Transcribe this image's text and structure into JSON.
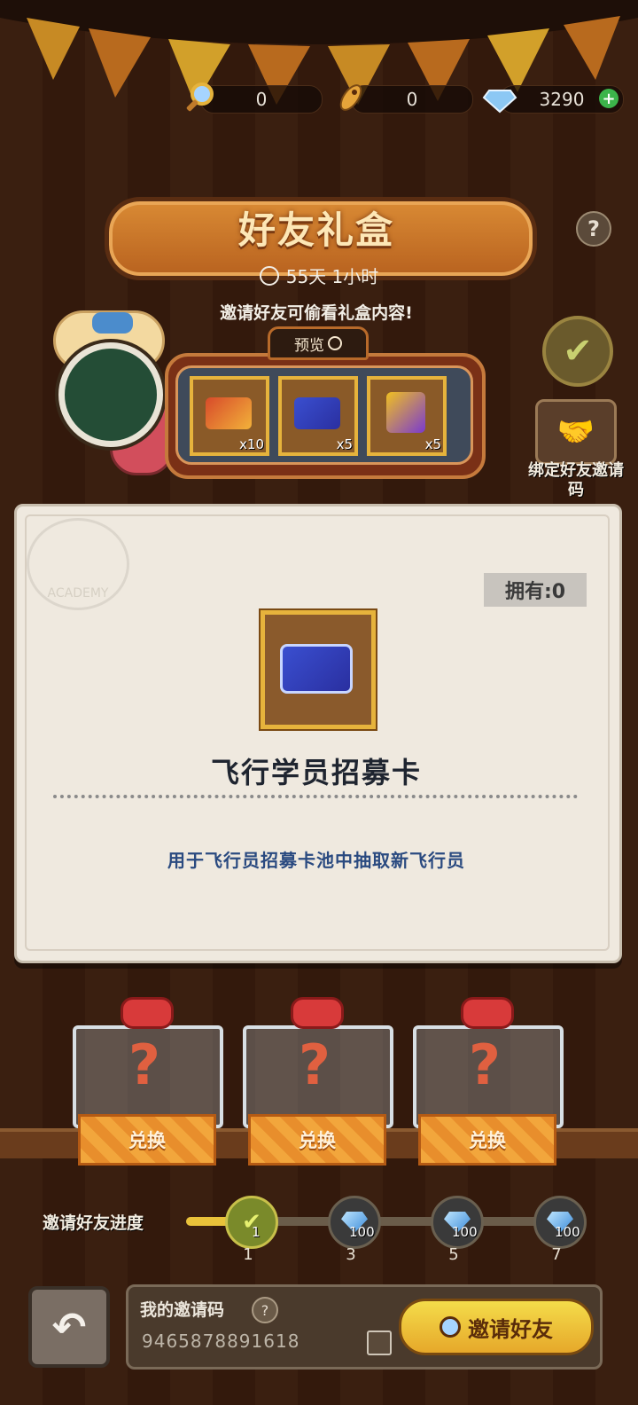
{
  "currency": {
    "magnifier_count": "0",
    "rocket_count": "0",
    "gem_count": "3290"
  },
  "header": {
    "title": "好友礼盒",
    "timer": "55天 1小时",
    "hint": "邀请好友可偷看礼盒内容!",
    "help": "?"
  },
  "preview": {
    "label": "预览",
    "slots": [
      {
        "icon": "gold-recruit-card-icon",
        "qty": "x10"
      },
      {
        "icon": "blue-recruit-card-icon",
        "qty": "x5"
      },
      {
        "icon": "cube-crate-icon",
        "qty": "x5"
      }
    ]
  },
  "side": {
    "bind_label": "绑定好友邀请码"
  },
  "modal": {
    "owned": "拥有:0",
    "item_name": "飞行学员招募卡",
    "item_desc": "用于飞行员招募卡池中抽取新飞行员",
    "stamp_text": "ACADEMY"
  },
  "gifts": [
    {
      "label": "兑换"
    },
    {
      "label": "兑换"
    },
    {
      "label": "兑换"
    }
  ],
  "progress": {
    "label": "邀请好友进度",
    "nodes": [
      {
        "count": "1",
        "reward": "1",
        "done": true
      },
      {
        "count": "3",
        "reward": "100",
        "done": false
      },
      {
        "count": "5",
        "reward": "100",
        "done": false
      },
      {
        "count": "7",
        "reward": "100",
        "done": false
      }
    ]
  },
  "invite": {
    "my_code_label": "我的邀请码",
    "code": "9465878891618",
    "button": "邀请好友"
  },
  "colors": {
    "accent_gold": "#e6b33c",
    "button_yellow": "#f4dc4a",
    "desc_blue": "#2a4a80"
  }
}
